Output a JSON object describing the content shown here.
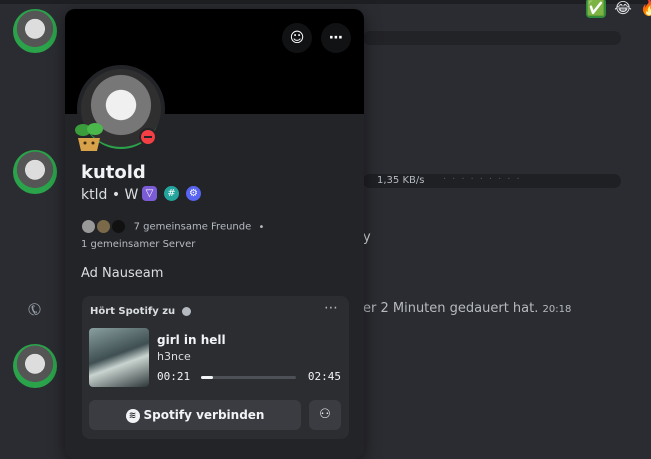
{
  "background": {
    "download_speed": "1,35 KB/s",
    "message_tail": "y",
    "call_text": "er 2 Minuten gedauert hat.",
    "call_time": "20:18",
    "reactions": [
      "✅",
      "😂",
      "🔥"
    ]
  },
  "profile": {
    "username": "kutold",
    "tagline": "ktld • W",
    "mutual_friends": "7 gemeinsame Freunde",
    "separator": "•",
    "mutual_server": "1 gemeinsamer Server",
    "bio": "Ad Nauseam",
    "status_color": "#f23f43",
    "badges": [
      "hypesquad-icon",
      "hashtag-icon",
      "gear-icon"
    ]
  },
  "activity": {
    "header": "Hört Spotify zu",
    "song": "girl in hell",
    "artist": "h3nce",
    "time_now": "00:21",
    "time_total": "02:45",
    "progress_fraction": 0.127,
    "connect_label": "Spotify verbinden",
    "spotify_color": "#1db954"
  }
}
